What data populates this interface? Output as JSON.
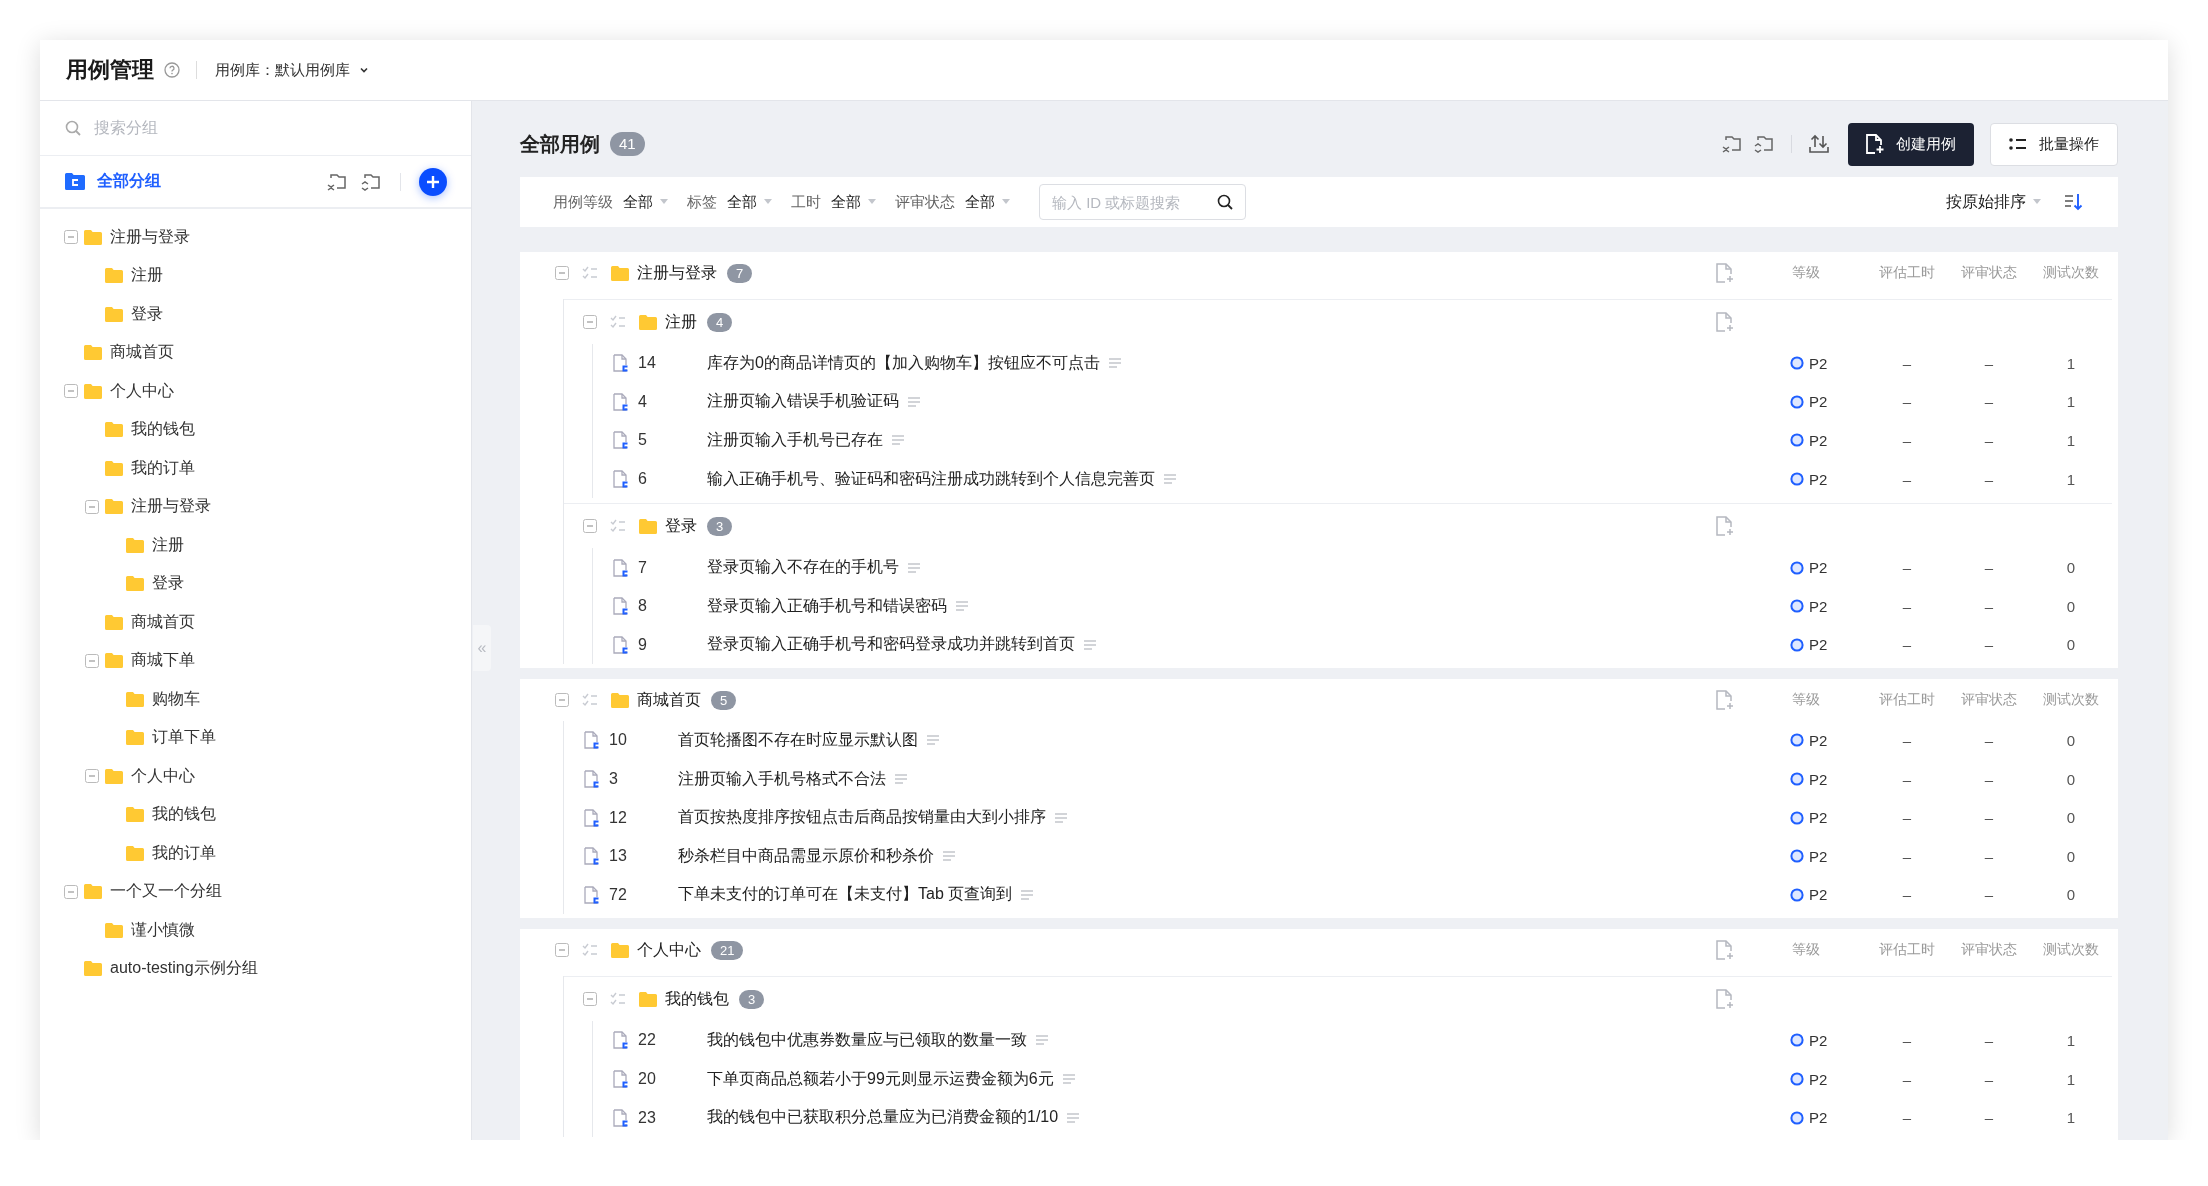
{
  "header": {
    "title": "用例管理",
    "library_label": "用例库：",
    "library": "默认用例库"
  },
  "sidebar": {
    "search_placeholder": "搜索分组",
    "all_groups": {
      "label": "全部分组",
      "selected": true
    },
    "tree": [
      {
        "label": "注册与登录",
        "expanded": true,
        "children": [
          {
            "label": "注册"
          },
          {
            "label": "登录"
          }
        ]
      },
      {
        "label": "商城首页"
      },
      {
        "label": "个人中心",
        "expanded": true,
        "children": [
          {
            "label": "我的钱包"
          },
          {
            "label": "我的订单"
          },
          {
            "label": "注册与登录",
            "expanded": true,
            "children": [
              {
                "label": "注册"
              },
              {
                "label": "登录"
              }
            ]
          },
          {
            "label": "商城首页"
          },
          {
            "label": "商城下单",
            "expanded": true,
            "children": [
              {
                "label": "购物车"
              },
              {
                "label": "订单下单"
              }
            ]
          },
          {
            "label": "个人中心",
            "expanded": true,
            "children": [
              {
                "label": "我的钱包"
              },
              {
                "label": "我的订单"
              }
            ]
          }
        ]
      },
      {
        "label": "一个又一个分组",
        "expanded": true,
        "children": [
          {
            "label": "谨小慎微"
          }
        ]
      },
      {
        "label": "auto-testing示例分组"
      }
    ],
    "collapse_handle": "«"
  },
  "main": {
    "title": "全部用例",
    "count": "41",
    "create_button": "创建用例",
    "batch_button": "批量操作",
    "filters": [
      {
        "label": "用例等级",
        "value": "全部"
      },
      {
        "label": "标签",
        "value": "全部"
      },
      {
        "label": "工时",
        "value": "全部"
      },
      {
        "label": "评审状态",
        "value": "全部"
      }
    ],
    "search_placeholder": "输入 ID 或标题搜索",
    "sort": "按原始排序",
    "sections": [
      {
        "name": "注册与登录",
        "count": "7",
        "expanded": true,
        "columns": [
          "等级",
          "评估工时",
          "评审状态",
          "测试次数"
        ],
        "subgroups": [
          {
            "name": "注册",
            "count": "4",
            "expanded": true,
            "cases": [
              {
                "id": "14",
                "title": "库存为0的商品详情页的【加入购物车】按钮应不可点击",
                "level": "P2",
                "hours": "–",
                "review": "–",
                "runs": "1"
              },
              {
                "id": "4",
                "title": "注册页输入错误手机验证码",
                "level": "P2",
                "hours": "–",
                "review": "–",
                "runs": "1"
              },
              {
                "id": "5",
                "title": "注册页输入手机号已存在",
                "level": "P2",
                "hours": "–",
                "review": "–",
                "runs": "1"
              },
              {
                "id": "6",
                "title": "输入正确手机号、验证码和密码注册成功跳转到个人信息完善页",
                "level": "P2",
                "hours": "–",
                "review": "–",
                "runs": "1"
              }
            ]
          },
          {
            "name": "登录",
            "count": "3",
            "expanded": true,
            "cases": [
              {
                "id": "7",
                "title": "登录页输入不存在的手机号",
                "level": "P2",
                "hours": "–",
                "review": "–",
                "runs": "0"
              },
              {
                "id": "8",
                "title": "登录页输入正确手机号和错误密码",
                "level": "P2",
                "hours": "–",
                "review": "–",
                "runs": "0"
              },
              {
                "id": "9",
                "title": "登录页输入正确手机号和密码登录成功并跳转到首页",
                "level": "P2",
                "hours": "–",
                "review": "–",
                "runs": "0"
              }
            ]
          }
        ]
      },
      {
        "name": "商城首页",
        "count": "5",
        "expanded": true,
        "columns": [
          "等级",
          "评估工时",
          "评审状态",
          "测试次数"
        ],
        "cases": [
          {
            "id": "10",
            "title": "首页轮播图不存在时应显示默认图",
            "level": "P2",
            "hours": "–",
            "review": "–",
            "runs": "0"
          },
          {
            "id": "3",
            "title": "注册页输入手机号格式不合法",
            "level": "P2",
            "hours": "–",
            "review": "–",
            "runs": "0"
          },
          {
            "id": "12",
            "title": "首页按热度排序按钮点击后商品按销量由大到小排序",
            "level": "P2",
            "hours": "–",
            "review": "–",
            "runs": "0"
          },
          {
            "id": "13",
            "title": "秒杀栏目中商品需显示原价和秒杀价",
            "level": "P2",
            "hours": "–",
            "review": "–",
            "runs": "0"
          },
          {
            "id": "72",
            "title": "下单未支付的订单可在【未支付】Tab 页查询到",
            "level": "P2",
            "hours": "–",
            "review": "–",
            "runs": "0"
          }
        ]
      },
      {
        "name": "个人中心",
        "count": "21",
        "expanded": true,
        "columns": [
          "等级",
          "评估工时",
          "评审状态",
          "测试次数"
        ],
        "subgroups": [
          {
            "name": "我的钱包",
            "count": "3",
            "expanded": true,
            "cases": [
              {
                "id": "22",
                "title": "我的钱包中优惠券数量应与已领取的数量一致",
                "level": "P2",
                "hours": "–",
                "review": "–",
                "runs": "1"
              },
              {
                "id": "20",
                "title": "下单页商品总额若小于99元则显示运费金额为6元",
                "level": "P2",
                "hours": "–",
                "review": "–",
                "runs": "1"
              },
              {
                "id": "23",
                "title": "我的钱包中已获取积分总量应为已消费金额的1/10",
                "level": "P2",
                "hours": "–",
                "review": "–",
                "runs": "1"
              }
            ]
          }
        ]
      }
    ]
  }
}
